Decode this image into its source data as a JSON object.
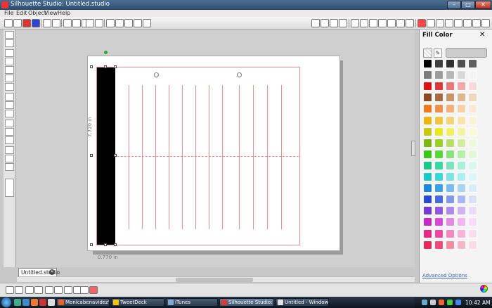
{
  "window": {
    "title": "Silhouette Studio: Untitled.studio",
    "minimize": "–",
    "maximize": "□",
    "close": "✕"
  },
  "menu": [
    "File",
    "Edit",
    "Object",
    "View",
    "Help"
  ],
  "document": {
    "tab_label": "Untitled.studio",
    "tab_close": "✕",
    "height_dimension": "7.720 in",
    "width_dimension": "0.770 in"
  },
  "fill_panel": {
    "title": "Fill Color",
    "close": "✕",
    "eyedropper": "✎",
    "advanced_link": "Advanced Options",
    "swatches": [
      [
        "#000000",
        "#404040",
        "#303030",
        "#505050",
        "#606060"
      ],
      [
        "#7c7c7c",
        "#9c9c9c",
        "#b8b8b8",
        "#d8d8d8",
        "#f4f4f4"
      ],
      [
        "#e01010",
        "#e03838",
        "#ea7878",
        "#f0a8a8",
        "#f8d8d8"
      ],
      [
        "#8a4a24",
        "#a86a3e",
        "#c89468",
        "#dcb890",
        "#eed8be"
      ],
      [
        "#f07818",
        "#f09048",
        "#f4b078",
        "#f8d0a8",
        "#fce8d8"
      ],
      [
        "#f0b410",
        "#f0c440",
        "#f4d478",
        "#f8e4a8",
        "#fcf2d8"
      ],
      [
        "#c8c810",
        "#e8e820",
        "#f0f060",
        "#f4f4a0",
        "#fafad8"
      ],
      [
        "#78b810",
        "#98d028",
        "#b8e068",
        "#d0ec9c",
        "#ecf8d8"
      ],
      [
        "#38c818",
        "#58d838",
        "#88e478",
        "#b4f0a8",
        "#e0f8d8"
      ],
      [
        "#18c888",
        "#38d8a0",
        "#78e4c0",
        "#a8f0d8",
        "#d8f8ec"
      ],
      [
        "#18c8c8",
        "#38d8d8",
        "#78e4e4",
        "#a8f0f0",
        "#d8f8f8"
      ],
      [
        "#1888e0",
        "#38a0e8",
        "#78bcf0",
        "#a8d4f4",
        "#d8ecfa"
      ],
      [
        "#2848d8",
        "#4868e0",
        "#8098ec",
        "#a8b8f4",
        "#d8e0fa"
      ],
      [
        "#7838d8",
        "#9058e0",
        "#b088ec",
        "#ccb4f4",
        "#e8dcfa"
      ],
      [
        "#c828c8",
        "#d848d8",
        "#e488e4",
        "#f0b4f0",
        "#f8dcf8"
      ],
      [
        "#e82888",
        "#f048a0",
        "#f488c0",
        "#f8b4d8",
        "#fcdcec"
      ],
      [
        "#e82858",
        "#f04878",
        "#f48aa0",
        "#f8b4c4",
        "#fcdce4"
      ]
    ]
  },
  "taskbar": {
    "items": [
      {
        "label": "Monicabenavidez's ...",
        "color": "#e8632a"
      },
      {
        "label": "TweetDeck",
        "color": "#f4c20d"
      },
      {
        "label": "iTunes",
        "color": "#7aa7d8"
      },
      {
        "label": "Silhouette Studio: U...",
        "color": "#d83a3a"
      },
      {
        "label": "Untitled - Windows ...",
        "color": "#e0e0e0"
      }
    ],
    "clock": "10:42 AM"
  }
}
